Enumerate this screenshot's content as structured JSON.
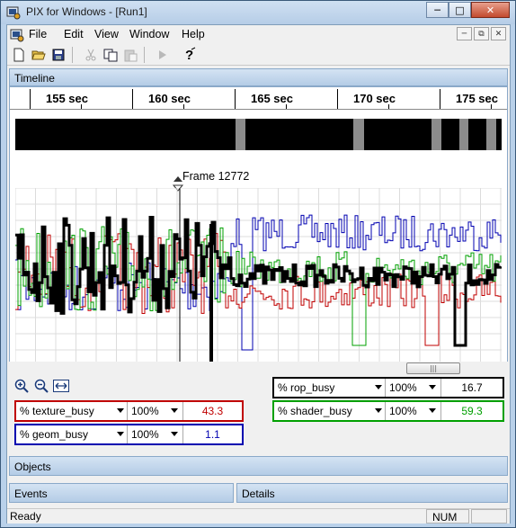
{
  "window": {
    "title": "PIX for Windows - [Run1]"
  },
  "menu": {
    "file": "File",
    "edit": "Edit",
    "view": "View",
    "window": "Window",
    "help": "Help"
  },
  "timeline": {
    "header": "Timeline",
    "ticks": [
      "155 sec",
      "160 sec",
      "165 sec",
      "170 sec",
      "175 sec"
    ],
    "frame_label": "Frame 12772"
  },
  "counters": {
    "rop": {
      "name": "% rop_busy",
      "scale": "100%",
      "value": "16.7",
      "color": "#000000"
    },
    "texture": {
      "name": "% texture_busy",
      "scale": "100%",
      "value": "43.3",
      "color": "#c00000"
    },
    "shader": {
      "name": "% shader_busy",
      "scale": "100%",
      "value": "59.3",
      "color": "#00a000"
    },
    "geom": {
      "name": "% geom_busy",
      "scale": "100%",
      "value": "1.1",
      "color": "#0000b0"
    }
  },
  "panels": {
    "objects": "Objects",
    "events": "Events",
    "details": "Details"
  },
  "status": {
    "ready": "Ready",
    "num": "NUM"
  }
}
